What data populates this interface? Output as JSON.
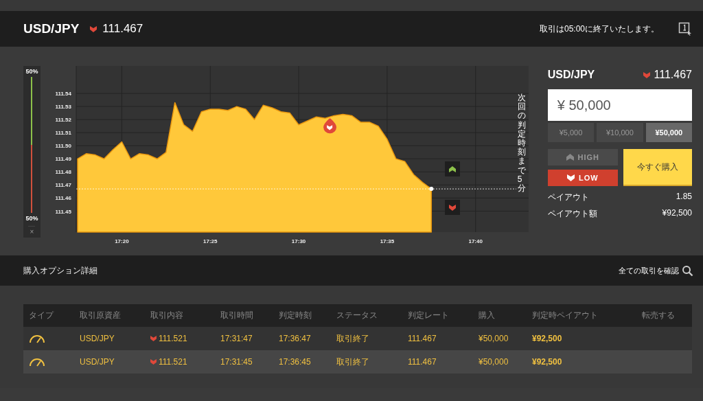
{
  "header": {
    "pair": "USD/JPY",
    "rising": false,
    "rate": "111.467",
    "notice": "取引は05:00に終了いたします。"
  },
  "sentiment": {
    "top_label": "50%",
    "bottom_label": "50%",
    "level": 0.5,
    "close": "×"
  },
  "chart": {
    "countdown": "次回の判定時刻まで5分",
    "chart_data": {
      "type": "area",
      "categories": [
        null,
        null,
        null,
        null,
        null,
        "17:20",
        null,
        null,
        null,
        null,
        null,
        null,
        null,
        null,
        null,
        "17:25",
        null,
        null,
        null,
        null,
        null,
        null,
        null,
        null,
        null,
        "17:30",
        null,
        null,
        null,
        null,
        null,
        null,
        null,
        null,
        null,
        "17:35",
        null,
        null,
        null,
        null,
        null,
        null,
        null,
        null,
        null,
        "17:40",
        null,
        null,
        null,
        null,
        null,
        null
      ],
      "series": [
        {
          "color": "#ffc83a",
          "values": [
            111.49,
            111.494,
            111.493,
            111.49,
            111.497,
            111.503,
            111.49,
            111.494,
            111.493,
            111.49,
            111.495,
            111.533,
            111.516,
            111.511,
            111.526,
            111.528,
            111.528,
            111.527,
            111.53,
            111.528,
            111.52,
            111.531,
            111.529,
            111.526,
            111.525,
            111.516,
            111.519,
            111.522,
            111.521,
            111.523,
            111.524,
            111.523,
            111.518,
            111.518,
            111.515,
            111.505,
            111.49,
            111.488,
            111.478,
            111.472,
            111.467,
            null,
            null,
            null,
            null,
            null,
            null,
            null,
            null,
            null,
            null,
            null
          ]
        }
      ],
      "ylim": [
        111.434,
        111.561
      ],
      "grid": true,
      "ref_lines": [
        {
          "axis": "y",
          "value": 111.467,
          "color": "#ffffff"
        }
      ],
      "yticks": [
        {
          "value": 111.45,
          "label": "111.45"
        },
        {
          "value": 111.46,
          "label": "111.46"
        },
        {
          "value": 111.47,
          "label": "111.47"
        },
        {
          "value": 111.48,
          "label": "111.48"
        },
        {
          "value": 111.49,
          "label": "111.49"
        },
        {
          "value": 111.5,
          "label": "111.50"
        },
        {
          "value": 111.51,
          "label": "111.51"
        },
        {
          "value": 111.52,
          "label": "111.52"
        },
        {
          "value": 111.53,
          "label": "111.53"
        },
        {
          "value": 111.54,
          "label": "111.54"
        }
      ]
    }
  },
  "trade_panel": {
    "pair": "USD/JPY",
    "rising": false,
    "rate": "111.467",
    "amount": "¥ 50,000",
    "presets": [
      {
        "label": "¥5,000",
        "selected": false
      },
      {
        "label": "¥10,000",
        "selected": false
      },
      {
        "label": "¥50,000",
        "selected": true
      }
    ],
    "options": [
      {
        "label": "HIGH",
        "kind": "up",
        "selected": false
      },
      {
        "label": "LOW",
        "kind": "down",
        "selected": true
      }
    ],
    "buy": "今すぐ購入",
    "payout_label": "ペイアウト",
    "payout": "1.85",
    "payout_amount_label": "ペイアウト額",
    "payout_amount": "¥92,500"
  },
  "details": {
    "title": "購入オプション詳細",
    "link": "全ての取引を確認",
    "columns": [
      "タイプ",
      "取引原資産",
      "取引内容",
      "取引時間",
      "判定時刻",
      "ステータス",
      "判定レート",
      "購入",
      "判定時ペイアウト",
      "転売する"
    ],
    "rows": [
      {
        "asset": "USD/JPY",
        "rising": false,
        "strike": "111.521",
        "trade_time": "17:31:47",
        "expiry": "17:36:47",
        "status": "取引終了",
        "rate": "111.467",
        "amount": "¥50,000",
        "payout": "¥92,500"
      },
      {
        "asset": "USD/JPY",
        "rising": false,
        "strike": "111.521",
        "trade_time": "17:31:45",
        "expiry": "17:36:45",
        "status": "取引終了",
        "rate": "111.467",
        "amount": "¥50,000",
        "payout": "¥92,500"
      }
    ]
  }
}
